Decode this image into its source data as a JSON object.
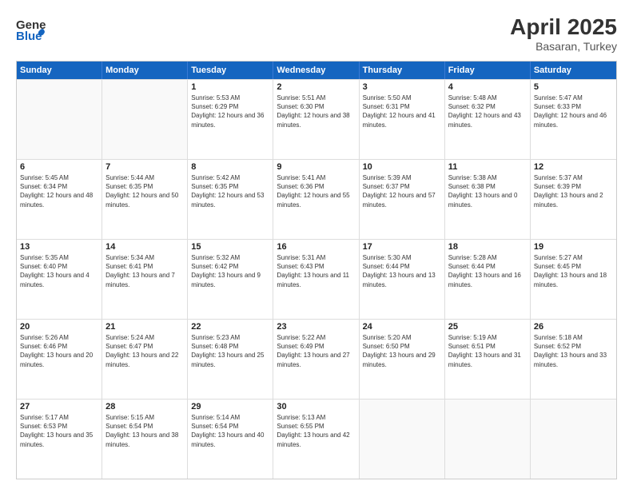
{
  "header": {
    "logo_general": "General",
    "logo_blue": "Blue",
    "title": "April 2025",
    "location": "Basaran, Turkey"
  },
  "weekdays": [
    "Sunday",
    "Monday",
    "Tuesday",
    "Wednesday",
    "Thursday",
    "Friday",
    "Saturday"
  ],
  "weeks": [
    [
      {
        "day": "",
        "empty": true
      },
      {
        "day": "",
        "empty": true
      },
      {
        "day": "1",
        "sunrise": "5:53 AM",
        "sunset": "6:29 PM",
        "daylight": "12 hours and 36 minutes."
      },
      {
        "day": "2",
        "sunrise": "5:51 AM",
        "sunset": "6:30 PM",
        "daylight": "12 hours and 38 minutes."
      },
      {
        "day": "3",
        "sunrise": "5:50 AM",
        "sunset": "6:31 PM",
        "daylight": "12 hours and 41 minutes."
      },
      {
        "day": "4",
        "sunrise": "5:48 AM",
        "sunset": "6:32 PM",
        "daylight": "12 hours and 43 minutes."
      },
      {
        "day": "5",
        "sunrise": "5:47 AM",
        "sunset": "6:33 PM",
        "daylight": "12 hours and 46 minutes."
      }
    ],
    [
      {
        "day": "6",
        "sunrise": "5:45 AM",
        "sunset": "6:34 PM",
        "daylight": "12 hours and 48 minutes."
      },
      {
        "day": "7",
        "sunrise": "5:44 AM",
        "sunset": "6:35 PM",
        "daylight": "12 hours and 50 minutes."
      },
      {
        "day": "8",
        "sunrise": "5:42 AM",
        "sunset": "6:35 PM",
        "daylight": "12 hours and 53 minutes."
      },
      {
        "day": "9",
        "sunrise": "5:41 AM",
        "sunset": "6:36 PM",
        "daylight": "12 hours and 55 minutes."
      },
      {
        "day": "10",
        "sunrise": "5:39 AM",
        "sunset": "6:37 PM",
        "daylight": "12 hours and 57 minutes."
      },
      {
        "day": "11",
        "sunrise": "5:38 AM",
        "sunset": "6:38 PM",
        "daylight": "13 hours and 0 minutes."
      },
      {
        "day": "12",
        "sunrise": "5:37 AM",
        "sunset": "6:39 PM",
        "daylight": "13 hours and 2 minutes."
      }
    ],
    [
      {
        "day": "13",
        "sunrise": "5:35 AM",
        "sunset": "6:40 PM",
        "daylight": "13 hours and 4 minutes."
      },
      {
        "day": "14",
        "sunrise": "5:34 AM",
        "sunset": "6:41 PM",
        "daylight": "13 hours and 7 minutes."
      },
      {
        "day": "15",
        "sunrise": "5:32 AM",
        "sunset": "6:42 PM",
        "daylight": "13 hours and 9 minutes."
      },
      {
        "day": "16",
        "sunrise": "5:31 AM",
        "sunset": "6:43 PM",
        "daylight": "13 hours and 11 minutes."
      },
      {
        "day": "17",
        "sunrise": "5:30 AM",
        "sunset": "6:44 PM",
        "daylight": "13 hours and 13 minutes."
      },
      {
        "day": "18",
        "sunrise": "5:28 AM",
        "sunset": "6:44 PM",
        "daylight": "13 hours and 16 minutes."
      },
      {
        "day": "19",
        "sunrise": "5:27 AM",
        "sunset": "6:45 PM",
        "daylight": "13 hours and 18 minutes."
      }
    ],
    [
      {
        "day": "20",
        "sunrise": "5:26 AM",
        "sunset": "6:46 PM",
        "daylight": "13 hours and 20 minutes."
      },
      {
        "day": "21",
        "sunrise": "5:24 AM",
        "sunset": "6:47 PM",
        "daylight": "13 hours and 22 minutes."
      },
      {
        "day": "22",
        "sunrise": "5:23 AM",
        "sunset": "6:48 PM",
        "daylight": "13 hours and 25 minutes."
      },
      {
        "day": "23",
        "sunrise": "5:22 AM",
        "sunset": "6:49 PM",
        "daylight": "13 hours and 27 minutes."
      },
      {
        "day": "24",
        "sunrise": "5:20 AM",
        "sunset": "6:50 PM",
        "daylight": "13 hours and 29 minutes."
      },
      {
        "day": "25",
        "sunrise": "5:19 AM",
        "sunset": "6:51 PM",
        "daylight": "13 hours and 31 minutes."
      },
      {
        "day": "26",
        "sunrise": "5:18 AM",
        "sunset": "6:52 PM",
        "daylight": "13 hours and 33 minutes."
      }
    ],
    [
      {
        "day": "27",
        "sunrise": "5:17 AM",
        "sunset": "6:53 PM",
        "daylight": "13 hours and 35 minutes."
      },
      {
        "day": "28",
        "sunrise": "5:15 AM",
        "sunset": "6:54 PM",
        "daylight": "13 hours and 38 minutes."
      },
      {
        "day": "29",
        "sunrise": "5:14 AM",
        "sunset": "6:54 PM",
        "daylight": "13 hours and 40 minutes."
      },
      {
        "day": "30",
        "sunrise": "5:13 AM",
        "sunset": "6:55 PM",
        "daylight": "13 hours and 42 minutes."
      },
      {
        "day": "",
        "empty": true
      },
      {
        "day": "",
        "empty": true
      },
      {
        "day": "",
        "empty": true
      }
    ]
  ]
}
